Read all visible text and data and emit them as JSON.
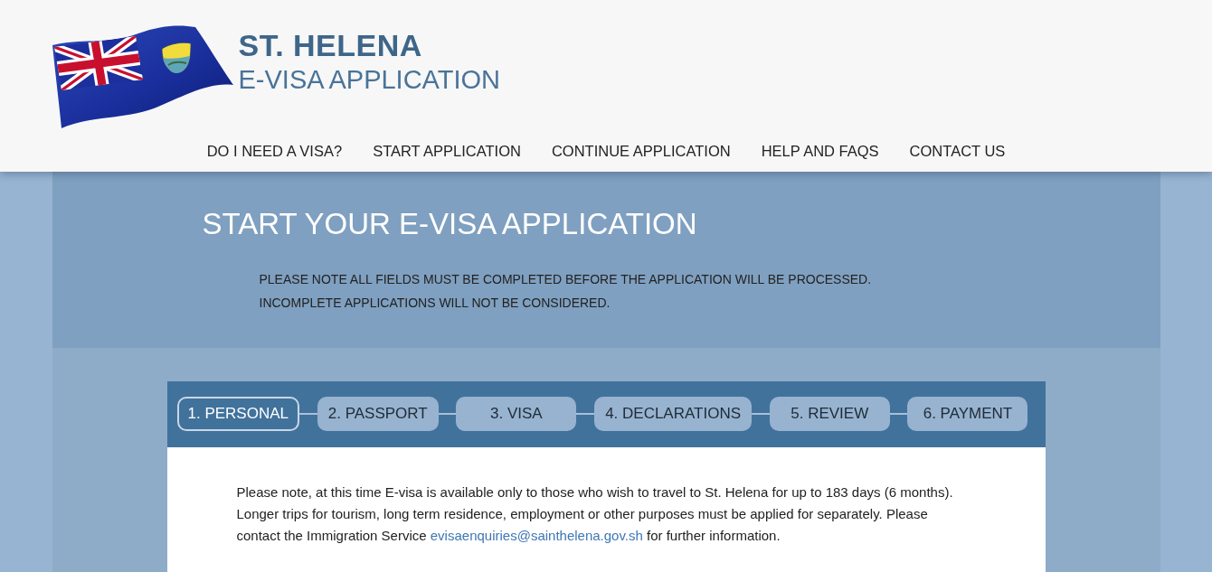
{
  "header": {
    "title": "ST. HELENA",
    "subtitle": "E-VISA APPLICATION"
  },
  "nav": [
    {
      "label": "DO I NEED A VISA?"
    },
    {
      "label": "START APPLICATION"
    },
    {
      "label": "CONTINUE APPLICATION"
    },
    {
      "label": "HELP AND FAQS"
    },
    {
      "label": "CONTACT US"
    }
  ],
  "intro": {
    "heading": "START YOUR E-VISA APPLICATION",
    "notes": [
      "PLEASE NOTE ALL FIELDS MUST BE COMPLETED BEFORE THE APPLICATION WILL BE PROCESSED.",
      "INCOMPLETE APPLICATIONS WILL NOT BE CONSIDERED."
    ]
  },
  "steps": [
    {
      "label": "1. PERSONAL",
      "selected": true
    },
    {
      "label": "2. PASSPORT",
      "selected": false
    },
    {
      "label": "3. VISA",
      "selected": false
    },
    {
      "label": "4. DECLARATIONS",
      "selected": false
    },
    {
      "label": "5. REVIEW",
      "selected": false
    },
    {
      "label": "6. PAYMENT",
      "selected": false
    }
  ],
  "notice": {
    "text_before": "Please note, at this time E-visa is available only to those who wish to travel to St. Helena for up to 183 days (6 months). Longer trips for tourism, long term residence, employment or other purposes must be applied for separately. Please contact the Immigration Service ",
    "link": "evisaenquiries@sainthelena.gov.sh",
    "text_after": " for further information."
  }
}
